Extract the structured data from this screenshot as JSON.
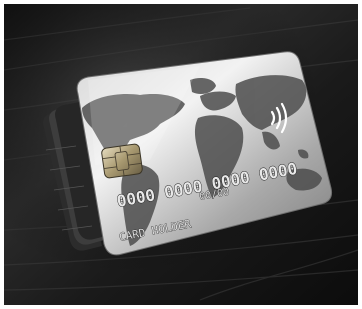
{
  "card": {
    "number": "0000 0000 0000 0000",
    "expiry": "00/00",
    "holder": "CARD HOLDER"
  },
  "icons": {
    "chip": "emv-chip-icon",
    "contactless": "contactless-icon",
    "map": "world-map-graphic"
  },
  "colors": {
    "background": "#1c1c1c",
    "card_silver": "#b8b8b8",
    "map_dark": "#4a4a4a",
    "chip_gold": "#8a7a55"
  }
}
